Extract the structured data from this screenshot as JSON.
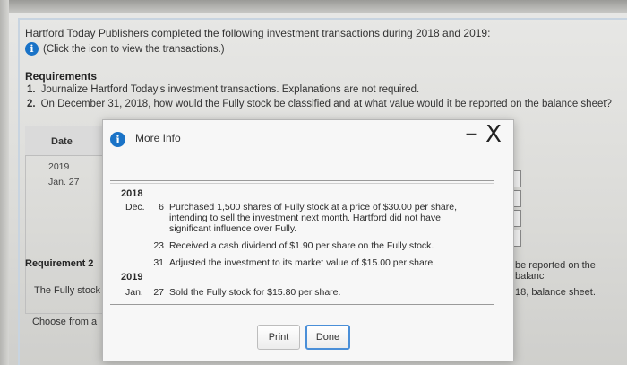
{
  "intro": "Hartford Today Publishers completed the following investment transactions during 2018 and 2019:",
  "click_hint": "(Click the icon to view the transactions.)",
  "requirements": {
    "title": "Requirements",
    "items": [
      {
        "num": "1.",
        "text": "Journalize Hartford Today's investment transactions. Explanations are not required."
      },
      {
        "num": "2.",
        "text": "On December 31, 2018, how would the Fully stock be classified and at what value would it be reported on the balance sheet?"
      }
    ]
  },
  "background": {
    "date_header": "Date",
    "year": "2019",
    "date": "Jan. 27",
    "requirement_label": "Requirement 2",
    "fully_text": "The Fully stock",
    "choose_text": "Choose from a",
    "right_text1": "be reported on the balanc",
    "right_text2": "18, balance sheet."
  },
  "modal": {
    "title": "More Info",
    "minimize_label": "–",
    "close_label": "X",
    "transactions": {
      "year1": "2018",
      "month1": "Dec.",
      "year2": "2019",
      "month2": "Jan.",
      "rows": [
        {
          "day": "6",
          "desc_lines": [
            "Purchased 1,500 shares of Fully stock at a price of $30.00 per share,",
            "intending to sell the investment next month. Hartford did not have",
            "significant influence over Fully."
          ]
        },
        {
          "day": "23",
          "desc_lines": [
            "Received a cash dividend of $1.90 per share on the Fully stock."
          ]
        },
        {
          "day": "31",
          "desc_lines": [
            "Adjusted the investment to its market value of $15.00 per share."
          ]
        },
        {
          "day": "27",
          "desc_lines": [
            "Sold the Fully stock for $15.80 per share."
          ]
        }
      ]
    },
    "print_label": "Print",
    "done_label": "Done"
  }
}
